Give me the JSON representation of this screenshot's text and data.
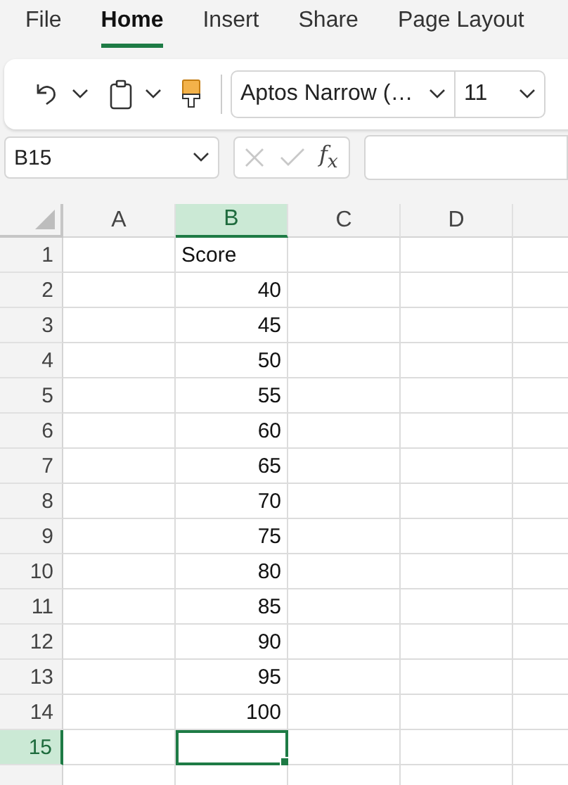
{
  "tabs": [
    {
      "label": "File",
      "selected": false
    },
    {
      "label": "Home",
      "selected": true
    },
    {
      "label": "Insert",
      "selected": false
    },
    {
      "label": "Share",
      "selected": false
    },
    {
      "label": "Page Layout",
      "selected": false
    }
  ],
  "toolbar": {
    "font": "Aptos Narrow (…",
    "font_size": "11"
  },
  "formula_bar": {
    "name_box": "B15",
    "function_label": "f$_{x}$"
  },
  "columns": [
    {
      "label": "A",
      "selected": false
    },
    {
      "label": "B",
      "selected": true
    },
    {
      "label": "C",
      "selected": false
    },
    {
      "label": "D",
      "selected": false
    }
  ],
  "rows": [
    {
      "label": "1",
      "selected": false,
      "value_b": {
        "kind": "text",
        "text": "Score"
      }
    },
    {
      "label": "2",
      "selected": false,
      "value_b": {
        "kind": "number",
        "text": "40"
      }
    },
    {
      "label": "3",
      "selected": false,
      "value_b": {
        "kind": "number",
        "text": "45"
      }
    },
    {
      "label": "4",
      "selected": false,
      "value_b": {
        "kind": "number",
        "text": "50"
      }
    },
    {
      "label": "5",
      "selected": false,
      "value_b": {
        "kind": "number",
        "text": "55"
      }
    },
    {
      "label": "6",
      "selected": false,
      "value_b": {
        "kind": "number",
        "text": "60"
      }
    },
    {
      "label": "7",
      "selected": false,
      "value_b": {
        "kind": "number",
        "text": "65"
      }
    },
    {
      "label": "8",
      "selected": false,
      "value_b": {
        "kind": "number",
        "text": "70"
      }
    },
    {
      "label": "9",
      "selected": false,
      "value_b": {
        "kind": "number",
        "text": "75"
      }
    },
    {
      "label": "10",
      "selected": false,
      "value_b": {
        "kind": "number",
        "text": "80"
      }
    },
    {
      "label": "11",
      "selected": false,
      "value_b": {
        "kind": "number",
        "text": "85"
      }
    },
    {
      "label": "12",
      "selected": false,
      "value_b": {
        "kind": "number",
        "text": "90"
      }
    },
    {
      "label": "13",
      "selected": false,
      "value_b": {
        "kind": "number",
        "text": "95"
      }
    },
    {
      "label": "14",
      "selected": false,
      "value_b": {
        "kind": "number",
        "text": "100"
      }
    },
    {
      "label": "15",
      "selected": true
    }
  ]
}
